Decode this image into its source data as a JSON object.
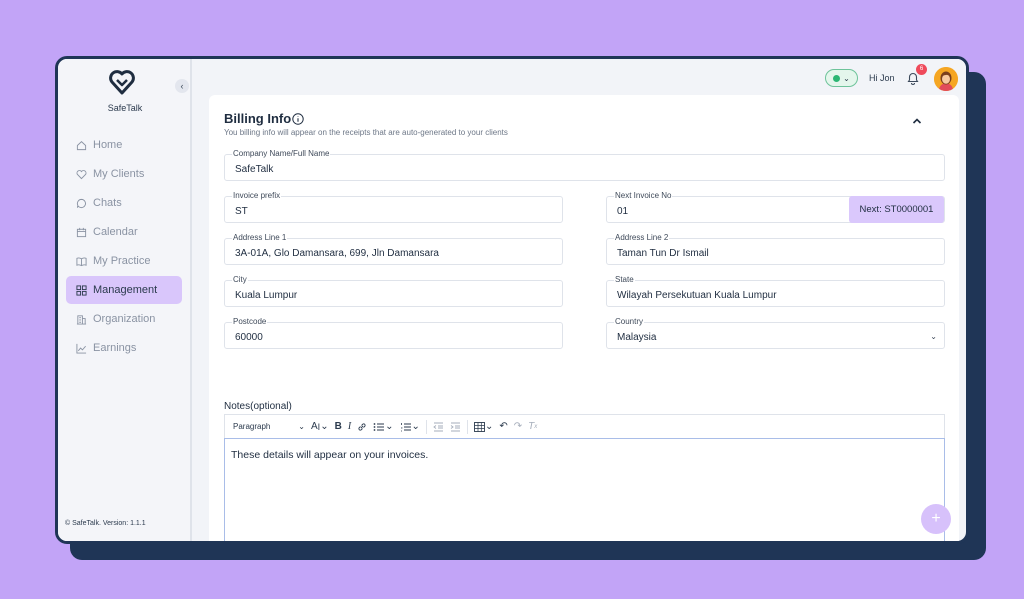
{
  "app": {
    "brand": "SafeTalk",
    "version": "© SafeTalk. Version: 1.1.1"
  },
  "sidebar": {
    "collapse": "‹",
    "items": [
      {
        "label": "Home",
        "icon": "home-icon",
        "active": false
      },
      {
        "label": "My Clients",
        "icon": "heart-icon",
        "active": false
      },
      {
        "label": "Chats",
        "icon": "chat-icon",
        "active": false
      },
      {
        "label": "Calendar",
        "icon": "calendar-icon",
        "active": false
      },
      {
        "label": "My Practice",
        "icon": "book-icon",
        "active": false
      },
      {
        "label": "Management",
        "icon": "grid-icon",
        "active": true
      },
      {
        "label": "Organization",
        "icon": "building-icon",
        "active": false
      },
      {
        "label": "Earnings",
        "icon": "chart-icon",
        "active": false
      }
    ]
  },
  "topbar": {
    "greeting": "Hi Jon",
    "notification_count": "6",
    "status": "online"
  },
  "billing": {
    "title": "Billing Info",
    "subtitle": "You billing info will appear on the receipts that are auto-generated to your clients",
    "company": {
      "label": "Company Name/Full Name",
      "value": "SafeTalk"
    },
    "invoice_prefix": {
      "label": "Invoice prefix",
      "value": "ST"
    },
    "next_invoice": {
      "label": "Next Invoice No",
      "value": "01",
      "button": "Next: ST0000001"
    },
    "address1": {
      "label": "Address Line 1",
      "value": "3A-01A, Glo Damansara, 699, Jln Damansara"
    },
    "address2": {
      "label": "Address Line 2",
      "value": "Taman Tun Dr Ismail"
    },
    "city": {
      "label": "City",
      "value": "Kuala Lumpur"
    },
    "state": {
      "label": "State",
      "value": "Wilayah Persekutuan Kuala Lumpur"
    },
    "postcode": {
      "label": "Postcode",
      "value": "60000"
    },
    "country": {
      "label": "Country",
      "value": "Malaysia"
    },
    "notes": {
      "label": "Notes(optional)",
      "paragraph": "Paragraph",
      "text": "These details will appear on your invoices."
    }
  },
  "colors": {
    "background": "#c2a4f7",
    "accent": "#dac8fc",
    "navy": "#1f3556",
    "status_green": "#2bb673"
  }
}
